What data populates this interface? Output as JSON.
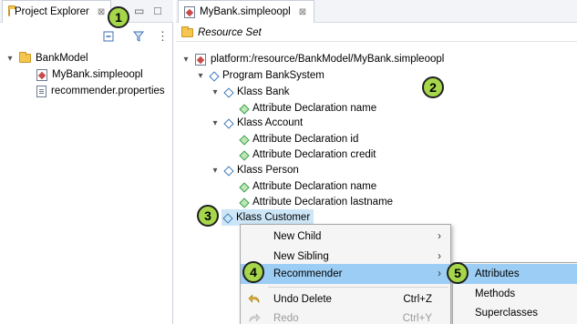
{
  "left_pane": {
    "tab_label": "Project Explorer",
    "tab_close": "⊠",
    "minimize": "▭",
    "maximize": "□",
    "toolbar_menu": "⋮",
    "tree": {
      "project": "BankModel",
      "files": [
        "MyBank.simpleoopl",
        "recommender.properties"
      ]
    }
  },
  "editor": {
    "tab_label": "MyBank.simpleoopl",
    "tab_close": "⊠",
    "header": "Resource Set",
    "resource": "platform:/resource/BankModel/MyBank.simpleoopl",
    "program": "Program BankSystem",
    "classes": [
      {
        "name": "Klass Bank",
        "attrs": [
          "Attribute Declaration name"
        ]
      },
      {
        "name": "Klass Account",
        "attrs": [
          "Attribute Declaration id",
          "Attribute Declaration credit"
        ]
      },
      {
        "name": "Klass Person",
        "attrs": [
          "Attribute Declaration name",
          "Attribute Declaration lastname"
        ]
      }
    ],
    "selected_class": "Klass Customer"
  },
  "context_menu": {
    "items": [
      {
        "label": "New Child",
        "submenu": true
      },
      {
        "label": "New Sibling",
        "submenu": true
      },
      {
        "label": "Recommender",
        "submenu": true,
        "selected": true
      },
      {
        "label": "Undo Delete",
        "accel": "Ctrl+Z"
      },
      {
        "label": "Redo",
        "accel": "Ctrl+Y",
        "disabled": true
      }
    ],
    "arrow": "›"
  },
  "submenu": {
    "items": [
      "Attributes",
      "Methods",
      "Superclasses"
    ]
  },
  "callouts": [
    "1",
    "2",
    "3",
    "4",
    "5"
  ],
  "colors": {
    "selection": "#9ccdf4",
    "callout": "#a6d64a",
    "tree_selection": "#cde6f7"
  }
}
